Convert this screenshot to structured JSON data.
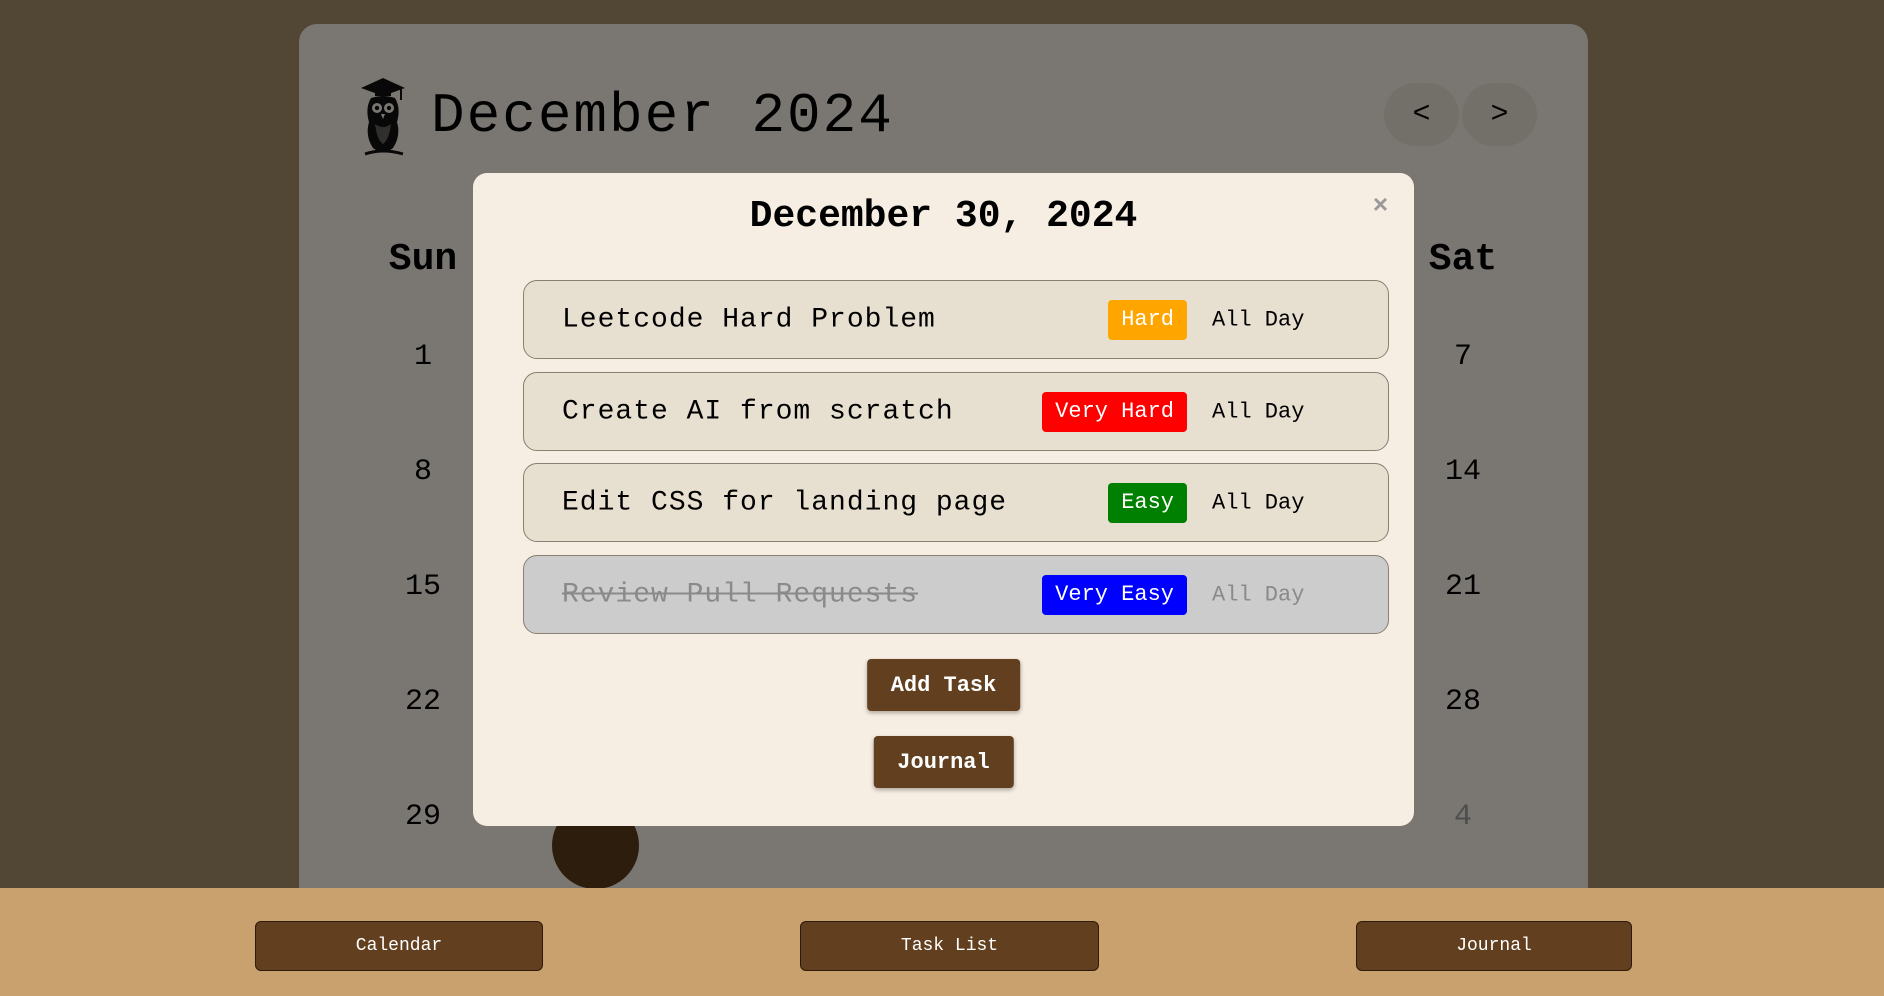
{
  "calendar": {
    "month_title": "December 2024",
    "prev_label": "<",
    "next_label": ">",
    "weekdays": {
      "sun": "Sun",
      "sat": "Sat"
    },
    "sun_days": [
      "1",
      "8",
      "15",
      "22",
      "29"
    ],
    "sat_days": [
      "7",
      "14",
      "21",
      "28",
      "4"
    ]
  },
  "modal": {
    "title": "December 30, 2024",
    "close_label": "×",
    "tasks": [
      {
        "name": "Leetcode Hard Problem",
        "difficulty": "Hard",
        "difficulty_color": "#ffa500",
        "time": "All Day",
        "completed": false
      },
      {
        "name": "Create AI from scratch",
        "difficulty": "Very Hard",
        "difficulty_color": "#ff0000",
        "time": "All Day",
        "completed": false
      },
      {
        "name": "Edit CSS for landing page",
        "difficulty": "Easy",
        "difficulty_color": "#008000",
        "time": "All Day",
        "completed": false
      },
      {
        "name": "Review Pull Requests",
        "difficulty": "Very Easy",
        "difficulty_color": "#0000ff",
        "time": "All Day",
        "completed": true
      }
    ],
    "add_task_label": "Add Task",
    "journal_label": "Journal"
  },
  "bottom_nav": {
    "calendar_label": "Calendar",
    "tasklist_label": "Task List",
    "journal_label": "Journal"
  },
  "colors": {
    "page_bg": "#a58f6b",
    "card_bg": "#f5efe4",
    "modal_bg": "#f7eee3",
    "brown_accent": "#62401f",
    "bottom_bar": "#c9a16e"
  }
}
